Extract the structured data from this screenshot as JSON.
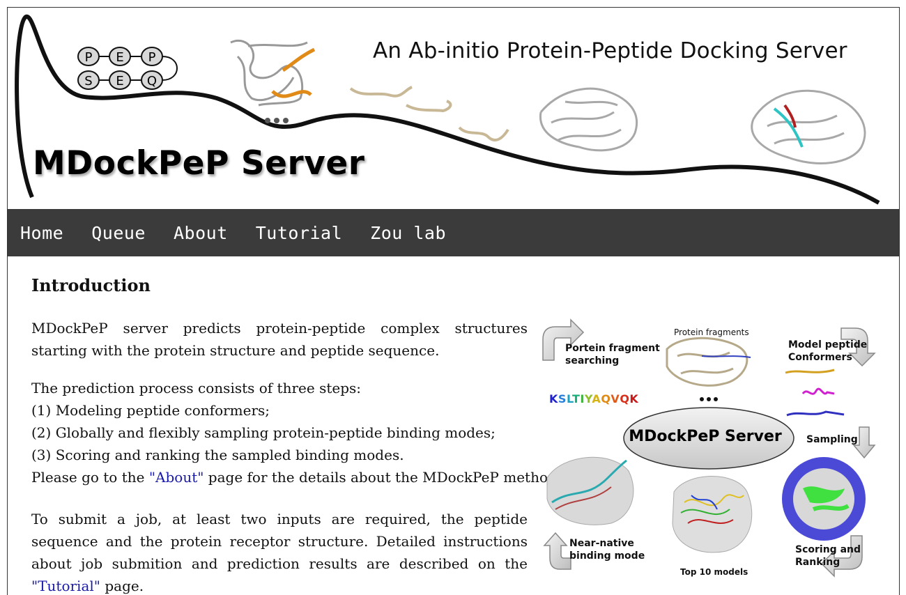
{
  "banner": {
    "logo_letters_top": [
      "P",
      "E",
      "P"
    ],
    "logo_letters_bottom": [
      "S",
      "E",
      "Q"
    ],
    "tagline": "An Ab-initio Protein-Peptide Docking Server",
    "brand": "MDockPeP Server"
  },
  "nav": {
    "items": [
      {
        "label": "Home"
      },
      {
        "label": "Queue"
      },
      {
        "label": "About"
      },
      {
        "label": "Tutorial"
      },
      {
        "label": "Zou lab"
      }
    ]
  },
  "intro": {
    "heading": "Introduction",
    "p1": "MDockPeP server predicts protein-peptide complex structures starting with the protein structure and peptide sequence.",
    "steps_intro": "The prediction process consists of three steps:",
    "step1": "(1) Modeling peptide conformers;",
    "step2": "(2) Globally and flexibly sampling protein-peptide binding modes;",
    "step3": "(3) Scoring and ranking the sampled binding modes.",
    "about_pre": "Please go to the ",
    "about_link": "\"About\"",
    "about_post": " page for the details about the MDockPeP method.",
    "submit_pre": "To submit a job, at least two inputs are required, the peptide sequence and the protein receptor structure. Detailed instructions about job submition and prediction results are described on the ",
    "tutorial_link": "\"Tutorial\"",
    "submit_post": " page."
  },
  "figure": {
    "fragment_search": "Portein fragment\nsearching",
    "protein_fragments": "Protein fragments",
    "model_conformers": "Model peptide\nConformers",
    "sequence": [
      "K",
      "S",
      "L",
      "T",
      "I",
      "Y",
      "A",
      "Q",
      "V",
      "Q",
      "K"
    ],
    "sequence_colors": [
      "#2222cc",
      "#2a7fd8",
      "#1aa0c0",
      "#18b07a",
      "#3cb43c",
      "#8ec028",
      "#d4b418",
      "#e08a18",
      "#e05a18",
      "#d8301a",
      "#c81818"
    ],
    "center": "MDockPeP Server",
    "sampling": "Sampling",
    "near_native": "Near-native\nbinding mode",
    "top_models": "Top 10 models",
    "scoring": "Scoring and\nRanking"
  },
  "colors": {
    "nav_bg": "#3b3b3b",
    "link": "#1a1aa8"
  }
}
